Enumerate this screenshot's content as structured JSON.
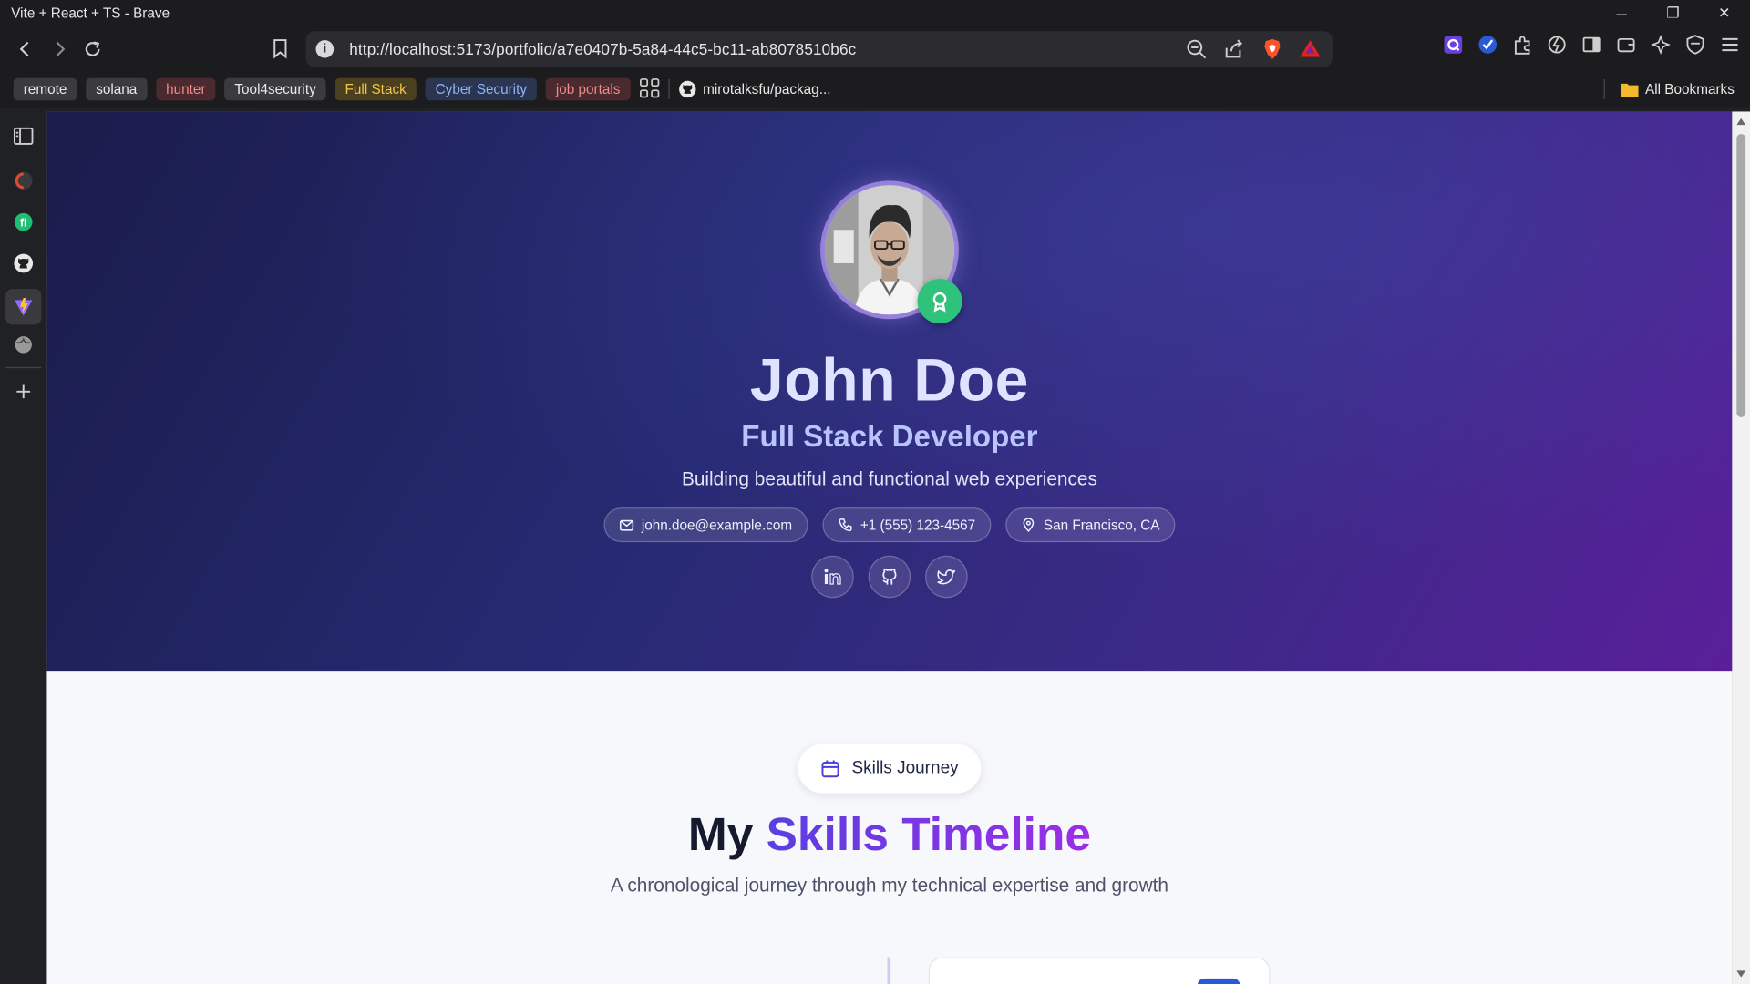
{
  "window": {
    "title": "Vite + React + TS - Brave",
    "minimize": "─",
    "restore": "❐",
    "close": "✕"
  },
  "navbar": {
    "url": "http://localhost:5173/portfolio/a7e0407b-5a84-44c5-bc11-ab8078510b6c",
    "info_glyph": "i"
  },
  "bookmarks": {
    "items": [
      {
        "label": "remote",
        "bg": "#3b3b3f",
        "color": "#e8e8e8"
      },
      {
        "label": "solana",
        "bg": "#3b3b3f",
        "color": "#e8e8e8"
      },
      {
        "label": "hunter",
        "bg": "#4a2a2e",
        "color": "#f08a8a"
      },
      {
        "label": "Tool4security",
        "bg": "#3b3b3f",
        "color": "#e8e8e8"
      },
      {
        "label": "Full Stack",
        "bg": "#4a3f1e",
        "color": "#f2c64c"
      },
      {
        "label": "Cyber Security",
        "bg": "#2c3550",
        "color": "#8ab4f8"
      },
      {
        "label": "job portals",
        "bg": "#4a2a2e",
        "color": "#f08a8a"
      }
    ],
    "github_link": "mirotalksfu/packag...",
    "all_bookmarks": "All Bookmarks"
  },
  "profile": {
    "name": "John Doe",
    "role": "Full Stack Developer",
    "tagline": "Building beautiful and functional web experiences",
    "email": "john.doe@example.com",
    "phone": "+1 (555) 123-4567",
    "location": "San Francisco, CA"
  },
  "skills": {
    "chip_label": "Skills Journey",
    "title_plain": "My",
    "title_accent": "Skills Timeline",
    "subtitle": "A chronological journey through my technical expertise and growth"
  },
  "colors": {
    "accent": "#7b3fe4",
    "badge": "#2fc27a",
    "hero_start": "#1a1c4a",
    "hero_end": "#5a1f9a"
  },
  "icons": {
    "sidebar": [
      "sidebar-toggle-icon",
      "brave-news-icon",
      "fiverr-icon",
      "github-icon",
      "vite-icon",
      "globe-icon",
      "add-icon"
    ],
    "socials": [
      "linkedin-icon",
      "github-icon",
      "twitter-icon"
    ]
  }
}
